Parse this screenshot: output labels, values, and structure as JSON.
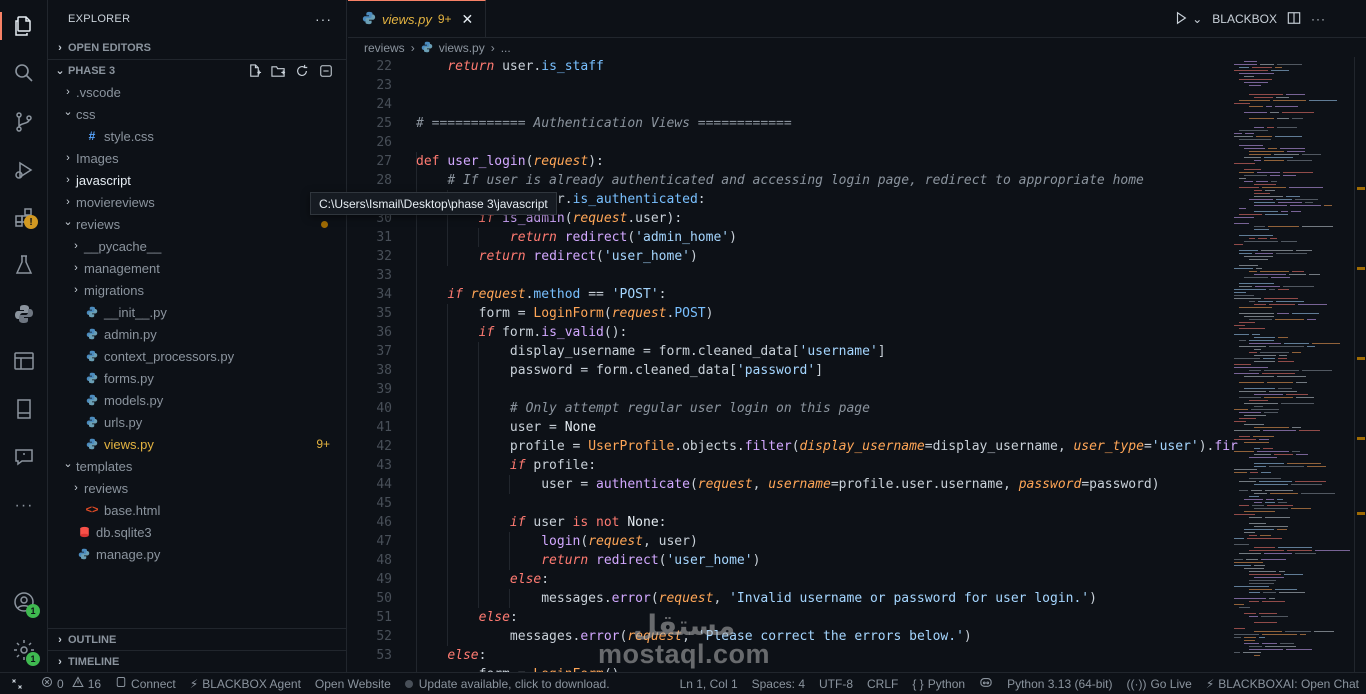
{
  "sidebar": {
    "title": "EXPLORER",
    "more": "···",
    "open_editors": "OPEN EDITORS",
    "project": "PHASE 3",
    "outline": "OUTLINE",
    "timeline": "TIMELINE",
    "tree": [
      {
        "label": ".vscode",
        "kind": "folder",
        "depth": 0,
        "open": false
      },
      {
        "label": "css",
        "kind": "folder",
        "depth": 0,
        "open": true
      },
      {
        "label": "style.css",
        "kind": "css",
        "depth": 1
      },
      {
        "label": "Images",
        "kind": "folder",
        "depth": 0,
        "open": false
      },
      {
        "label": "javascript",
        "kind": "folder",
        "depth": 0,
        "open": false
      },
      {
        "label": "moviereviews",
        "kind": "folder",
        "depth": 0,
        "open": false
      },
      {
        "label": "reviews",
        "kind": "folder",
        "depth": 0,
        "open": true
      },
      {
        "label": "__pycache__",
        "kind": "folder",
        "depth": 1,
        "open": false
      },
      {
        "label": "management",
        "kind": "folder",
        "depth": 1,
        "open": false
      },
      {
        "label": "migrations",
        "kind": "folder",
        "depth": 1,
        "open": false
      },
      {
        "label": "__init__.py",
        "kind": "py",
        "depth": 1
      },
      {
        "label": "admin.py",
        "kind": "py",
        "depth": 1
      },
      {
        "label": "context_processors.py",
        "kind": "py",
        "depth": 1
      },
      {
        "label": "forms.py",
        "kind": "py",
        "depth": 1
      },
      {
        "label": "models.py",
        "kind": "py",
        "depth": 1
      },
      {
        "label": "urls.py",
        "kind": "py",
        "depth": 1
      },
      {
        "label": "views.py",
        "kind": "py",
        "depth": 1,
        "deco": "9+"
      },
      {
        "label": "templates",
        "kind": "folder",
        "depth": 0,
        "open": true
      },
      {
        "label": "reviews",
        "kind": "folder",
        "depth": 1,
        "open": false
      },
      {
        "label": "base.html",
        "kind": "html",
        "depth": 1
      },
      {
        "label": "db.sqlite3",
        "kind": "db",
        "depth": 0
      },
      {
        "label": "manage.py",
        "kind": "py",
        "depth": 0
      }
    ]
  },
  "tooltip": "C:\\Users\\Ismail\\Desktop\\phase 3\\javascript",
  "editor": {
    "tab": {
      "name": "views.py",
      "count": "9+",
      "close": "✕"
    },
    "actions": {
      "label": "BLACKBOX"
    },
    "breadcrumb": {
      "folder": "reviews",
      "file": "views.py",
      "more": "..."
    },
    "lines": [
      22,
      23,
      24,
      25,
      26,
      27,
      28,
      29,
      30,
      31,
      32,
      33,
      34,
      35,
      36,
      37,
      38,
      39,
      40,
      41,
      42,
      43,
      44,
      45,
      46,
      47,
      48,
      49,
      50,
      51,
      52,
      53
    ]
  },
  "watermark": {
    "arabic": "مستقل",
    "latin": "mostaql.com"
  },
  "statusbar": {
    "errors": "0",
    "warnings": "16",
    "connect": "Connect",
    "agent": "BLACKBOX Agent",
    "open_website": "Open Website",
    "update": "Update available, click to download.",
    "position": "Ln 1, Col 1",
    "spaces": "Spaces: 4",
    "encoding": "UTF-8",
    "eol": "CRLF",
    "language": "Python",
    "interpreter": "Python 3.13 (64-bit)",
    "golive": "Go Live",
    "chat": "BLACKBOXAI: Open Chat"
  },
  "activity": {
    "accounts_badge": "1",
    "settings_badge": "1",
    "extensions_warn": "!"
  },
  "colors": {
    "accent": "#f78166",
    "warning": "#e3b341"
  }
}
